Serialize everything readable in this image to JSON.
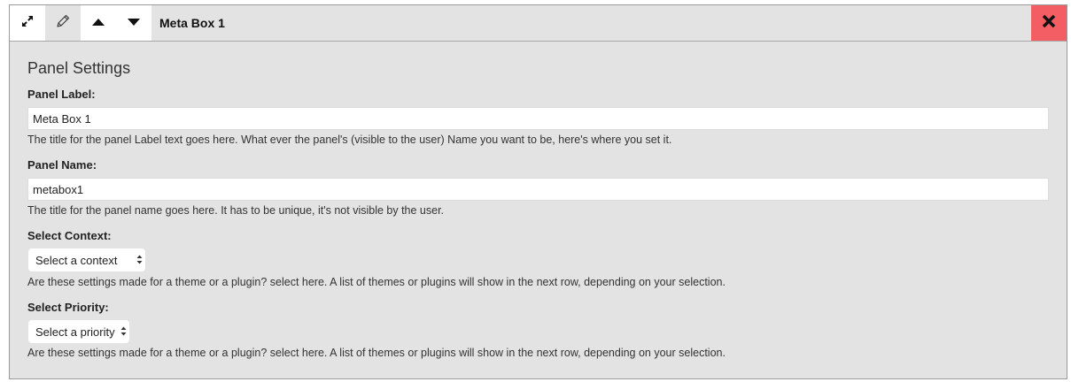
{
  "header": {
    "title": "Meta Box 1",
    "icons": {
      "expand": "expand-icon",
      "edit": "pencil-icon",
      "move_up": "arrow-up-icon",
      "move_down": "arrow-down-icon",
      "close": "close-icon"
    },
    "close_color": "#f25e63"
  },
  "settings": {
    "title": "Panel Settings",
    "panel_label": {
      "label": "Panel Label:",
      "value": "Meta Box 1",
      "help": "The title for the panel Label text goes here. What ever the panel's (visible to the user) Name you want to be, here's where you set it."
    },
    "panel_name": {
      "label": "Panel Name:",
      "value": "metabox1",
      "help": "The title for the panel name goes here. It has to be unique, it's not visible by the user."
    },
    "context": {
      "label": "Select Context:",
      "selected": "Select a context",
      "help": "Are these settings made for a theme or a plugin? select here. A list of themes or plugins will show in the next row, depending on your selection."
    },
    "priority": {
      "label": "Select Priority:",
      "selected": "Select a priority",
      "help": "Are these settings made for a theme or a plugin? select here. A list of themes or plugins will show in the next row, depending on your selection."
    }
  }
}
